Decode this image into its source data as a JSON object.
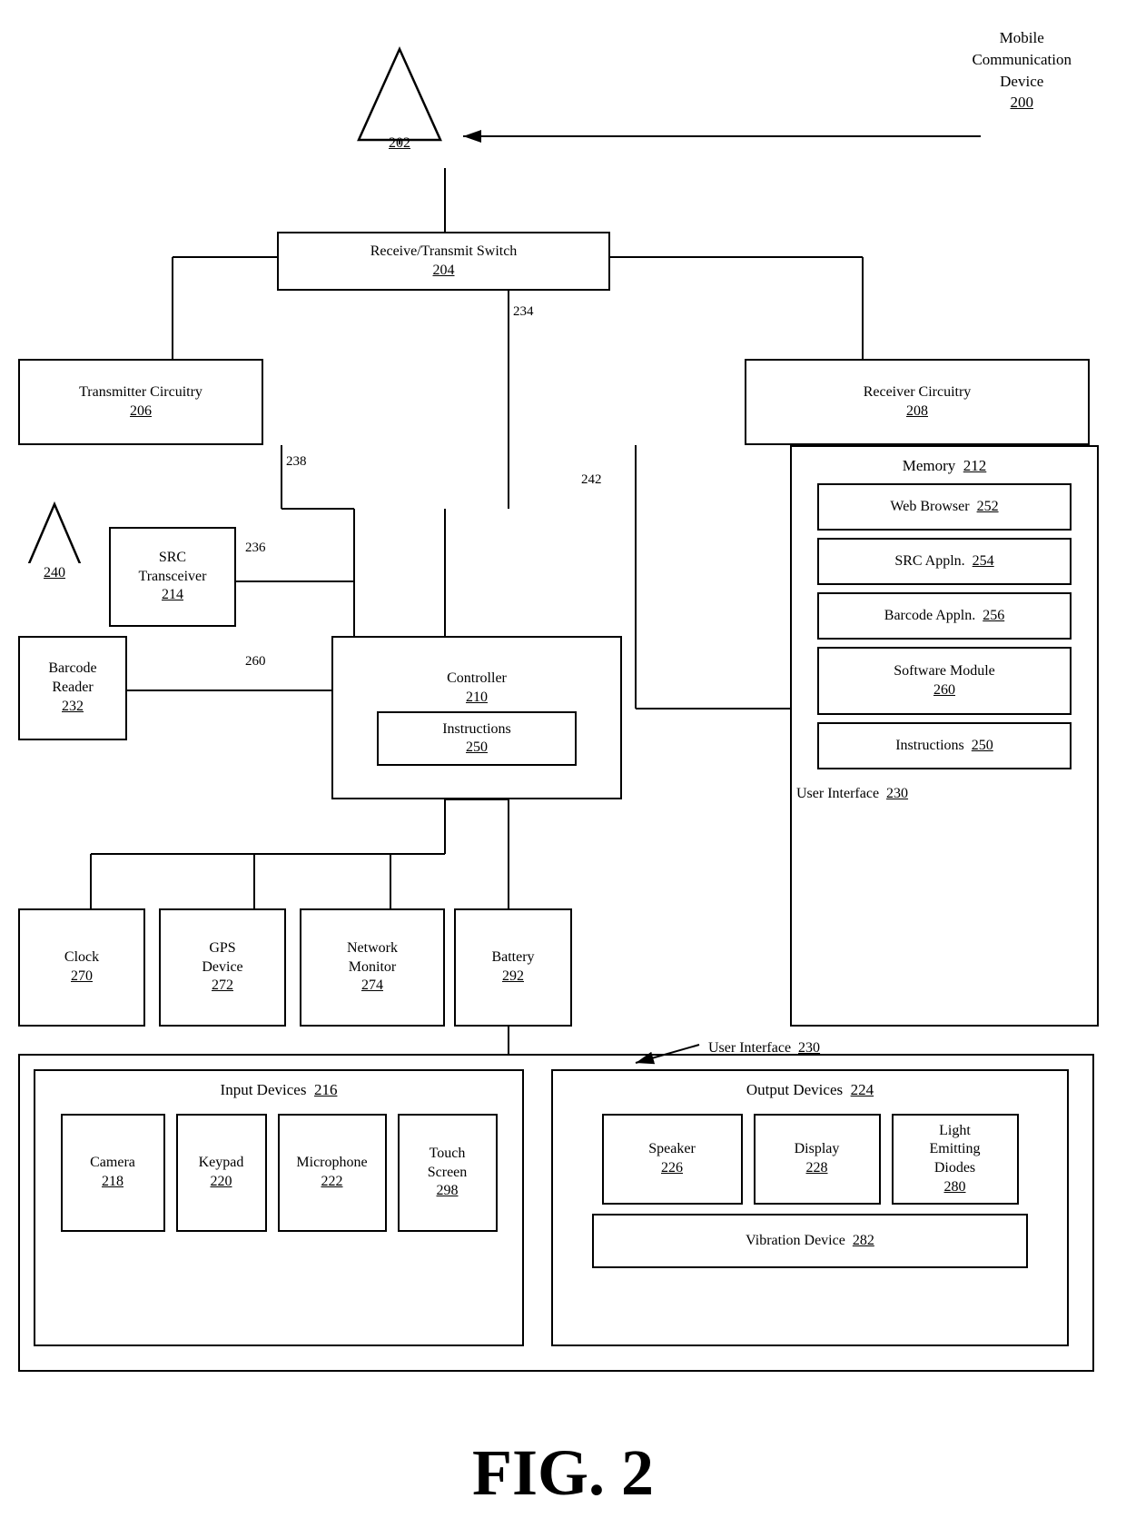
{
  "diagram": {
    "title": "FIG. 2",
    "mobile_device_label": "Mobile\nCommunication\nDevice\n200",
    "components": {
      "antenna_202": {
        "label": "202"
      },
      "switch_204": {
        "label": "Receive/Transmit Switch",
        "num": "204"
      },
      "transmitter_206": {
        "label": "Transmitter Circuitry",
        "num": "206"
      },
      "receiver_208": {
        "label": "Receiver Circuitry",
        "num": "208"
      },
      "controller_210": {
        "label": "Controller",
        "num": "210"
      },
      "instructions_250_ctrl": {
        "label": "Instructions",
        "num": "250"
      },
      "memory_212": {
        "label": "Memory",
        "num": "212"
      },
      "web_browser_252": {
        "label": "Web Browser",
        "num": "252"
      },
      "src_appln_254": {
        "label": "SRC Appln.",
        "num": "254"
      },
      "barcode_appln_256": {
        "label": "Barcode Appln.",
        "num": "256"
      },
      "software_module_260": {
        "label": "Software Module",
        "num": "260"
      },
      "instructions_250_mem": {
        "label": "Instructions",
        "num": "250"
      },
      "src_transceiver_214": {
        "label": "SRC\nTransceiver",
        "num": "214"
      },
      "barcode_reader_232": {
        "label": "Barcode\nReader",
        "num": "232"
      },
      "clock_270": {
        "label": "Clock",
        "num": "270"
      },
      "gps_272": {
        "label": "GPS\nDevice",
        "num": "272"
      },
      "network_monitor_274": {
        "label": "Network\nMonitor",
        "num": "274"
      },
      "battery_292": {
        "label": "Battery",
        "num": "292"
      },
      "user_interface_230": {
        "label": "User Interface",
        "num": "230"
      },
      "input_devices_216": {
        "label": "Input Devices",
        "num": "216"
      },
      "camera_218": {
        "label": "Camera",
        "num": "218"
      },
      "keypad_220": {
        "label": "Keypad",
        "num": "220"
      },
      "microphone_222": {
        "label": "Microphone",
        "num": "222"
      },
      "touch_screen_298": {
        "label": "Touch\nScreen",
        "num": "298"
      },
      "output_devices_224": {
        "label": "Output Devices",
        "num": "224"
      },
      "speaker_226": {
        "label": "Speaker",
        "num": "226"
      },
      "display_228": {
        "label": "Display",
        "num": "228"
      },
      "led_280": {
        "label": "Light\nEmitting\nDiodes",
        "num": "280"
      },
      "vibration_282": {
        "label": "Vibration Device",
        "num": "282"
      },
      "antenna_240": {
        "label": "240"
      },
      "ref_236": "236",
      "ref_238": "238",
      "ref_234": "234",
      "ref_242": "242",
      "ref_260": "260"
    }
  }
}
